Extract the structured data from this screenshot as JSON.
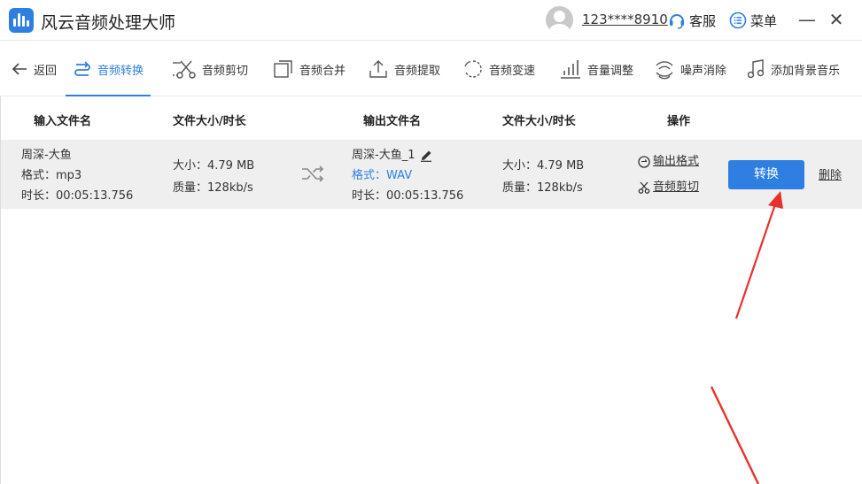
{
  "app": {
    "title": "风云音频处理大师"
  },
  "header": {
    "account": "123****8910",
    "service_label": "客服",
    "menu_label": "菜单",
    "minimize": "—",
    "close": "✕"
  },
  "toolbar": {
    "back_label": "返回",
    "tools": [
      {
        "label": "音频转换",
        "icon": "convert-icon",
        "active": true
      },
      {
        "label": "音频剪切",
        "icon": "cut-icon",
        "active": false
      },
      {
        "label": "音频合并",
        "icon": "merge-icon",
        "active": false
      },
      {
        "label": "音频提取",
        "icon": "extract-icon",
        "active": false
      },
      {
        "label": "音频变速",
        "icon": "speed-icon",
        "active": false
      },
      {
        "label": "音量调整",
        "icon": "volume-icon",
        "active": false
      },
      {
        "label": "噪声消除",
        "icon": "noise-icon",
        "active": false
      },
      {
        "label": "添加背景音乐",
        "icon": "music-icon",
        "active": false
      }
    ]
  },
  "table": {
    "headers": {
      "input_name": "输入文件名",
      "input_size": "文件大小/时长",
      "output_name": "输出文件名",
      "output_size": "文件大小/时长",
      "action": "操作"
    },
    "row": {
      "input_name": "周深-大鱼",
      "input_format": "格式：mp3",
      "input_duration": "时长：00:05:13.756",
      "input_size": "大小：4.79 MB",
      "input_quality": "质量：128kb/s",
      "output_name": "周深-大鱼_1",
      "output_format": "格式：WAV",
      "output_duration": "时长：00:05:13.756",
      "output_size": "大小：4.79 MB",
      "output_quality": "质量：128kb/s",
      "output_format_link": "输出格式",
      "audio_cut_link": "音频剪切",
      "convert_button": "转换",
      "delete_link": "删除"
    }
  },
  "colors": {
    "accent": "#2f7fe3",
    "arrow": "#e8312a",
    "row_bg": "#efefef"
  }
}
